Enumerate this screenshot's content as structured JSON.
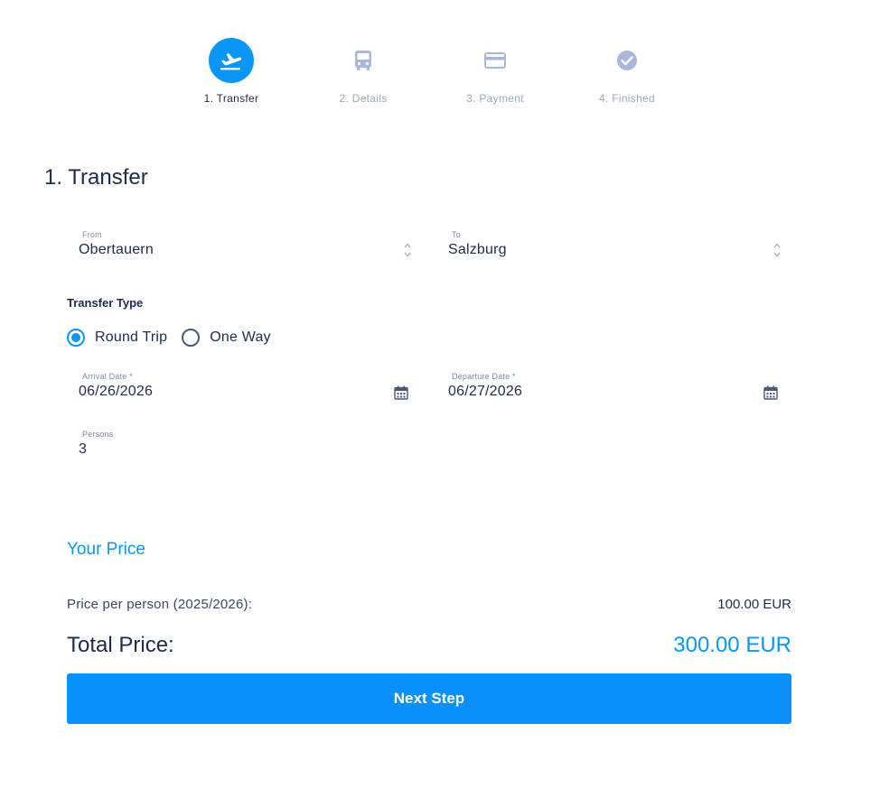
{
  "stepper": {
    "steps": [
      {
        "label": "1. Transfer",
        "icon": "plane-takeoff-icon",
        "active": true
      },
      {
        "label": "2. Details",
        "icon": "bus-icon",
        "active": false
      },
      {
        "label": "3. Payment",
        "icon": "credit-card-icon",
        "active": false
      },
      {
        "label": "4. Finished",
        "icon": "check-circle-icon",
        "active": false
      }
    ]
  },
  "page": {
    "title": "1. Transfer"
  },
  "form": {
    "from": {
      "label": "From",
      "value": "Obertauern"
    },
    "to": {
      "label": "To",
      "value": "Salzburg"
    },
    "transfer_type": {
      "label": "Transfer Type",
      "options": [
        {
          "label": "Round Trip",
          "checked": true
        },
        {
          "label": "One Way",
          "checked": false
        }
      ]
    },
    "arrival_date": {
      "label": "Arrival Date *",
      "value": "06/26/2026"
    },
    "departure_date": {
      "label": "Departure Date *",
      "value": "06/27/2026"
    },
    "persons": {
      "label": "Persons",
      "value": "3"
    }
  },
  "price": {
    "heading": "Your Price",
    "per_person_label": "Price per person (2025/2026):",
    "per_person_value": "100.00 EUR",
    "total_label": "Total Price:",
    "total_value": "300.00 EUR"
  },
  "actions": {
    "next_label": "Next Step"
  },
  "colors": {
    "accent": "#0a96f5",
    "text": "#1e2a4a",
    "muted": "#9aa6c4"
  }
}
